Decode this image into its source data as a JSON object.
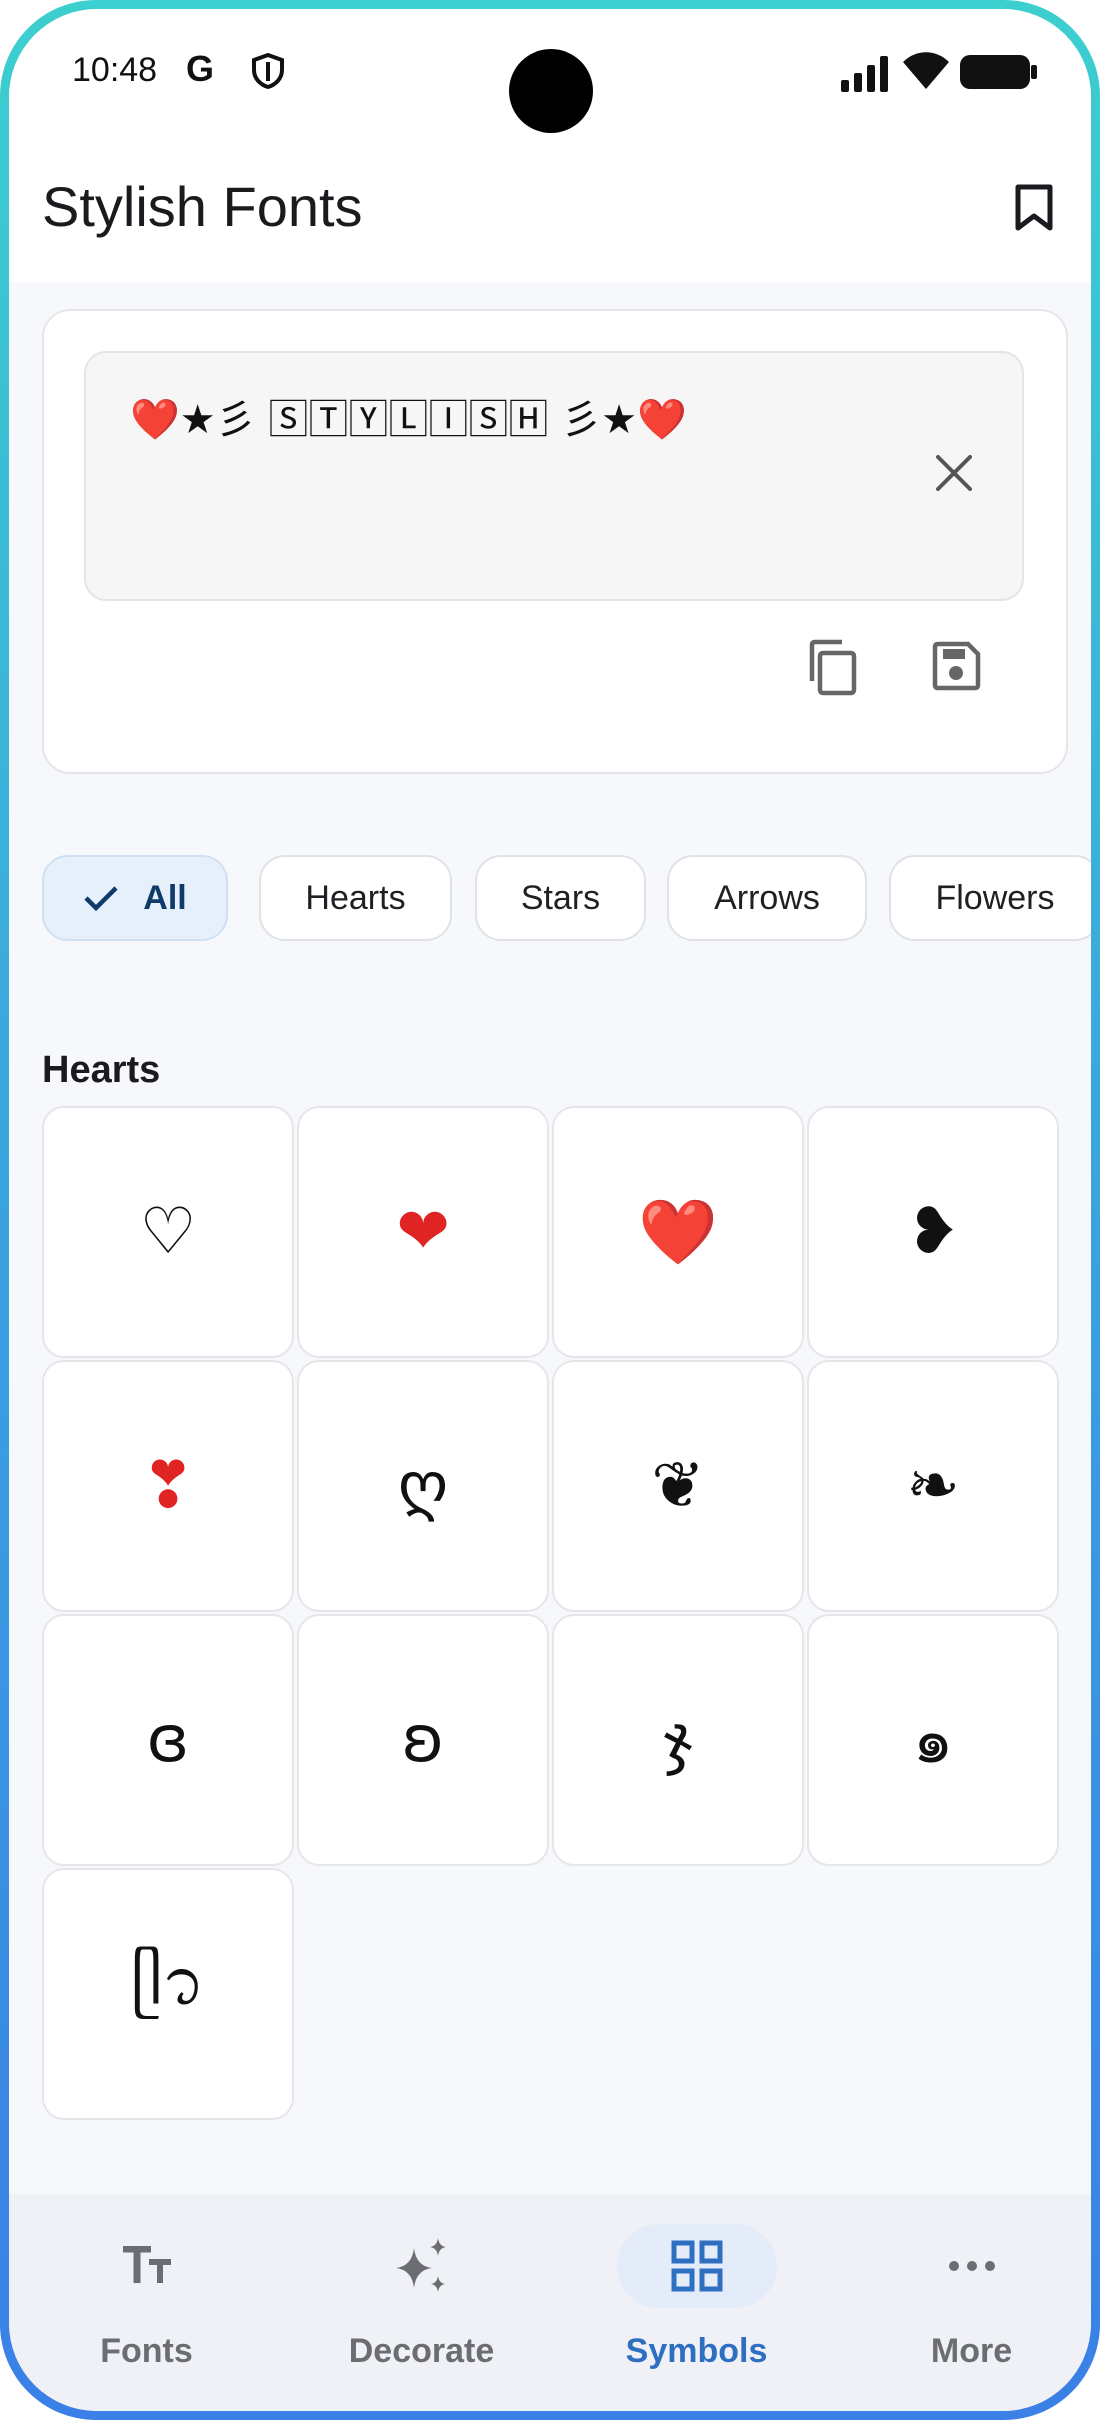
{
  "status": {
    "time": "10:48",
    "g_label": "G"
  },
  "appbar": {
    "title": "Stylish Fonts"
  },
  "editor": {
    "text": "❤️★彡 🅂🅃🅈🄻🄸🅂🄷 彡★❤️"
  },
  "chips": [
    {
      "label": "All",
      "selected": true
    },
    {
      "label": "Hearts"
    },
    {
      "label": "Stars"
    },
    {
      "label": "Arrows"
    },
    {
      "label": "Flowers"
    }
  ],
  "section": {
    "title": "Hearts"
  },
  "symbols": [
    "♡",
    "❤",
    "❤️",
    "❥",
    "❣",
    "ღ",
    "❦",
    "❧",
    "ɞ",
    "ʚ",
    "ჯ",
    "๑",
    "ᥫ᭡"
  ],
  "nav": [
    {
      "label": "Fonts",
      "icon": "text-format-icon"
    },
    {
      "label": "Decorate",
      "icon": "sparkles-icon"
    },
    {
      "label": "Symbols",
      "icon": "grid-icon",
      "active": true
    },
    {
      "label": "More",
      "icon": "more-horizontal-icon"
    }
  ],
  "colors": {
    "accent": "#2f6fc2",
    "heart_red": "#e02424",
    "frame_top": "#3ccfcf",
    "frame_bottom": "#3a80e6"
  }
}
